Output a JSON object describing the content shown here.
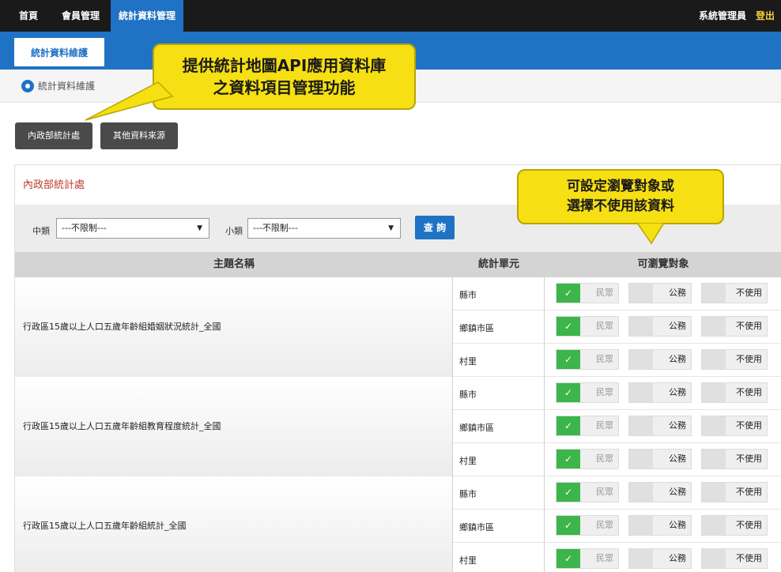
{
  "nav": {
    "items": [
      {
        "label": "首頁"
      },
      {
        "label": "會員管理"
      },
      {
        "label": "統計資料管理"
      }
    ],
    "user": "系統管理員",
    "logout": "登出"
  },
  "subnav": {
    "active_tab": "統計資料維護"
  },
  "breadcrumb": {
    "text": "統計資料維護"
  },
  "sources": {
    "buttons": [
      {
        "label": "內政部統計處"
      },
      {
        "label": "其他資料來源"
      }
    ]
  },
  "panel": {
    "title": "內政部統計處"
  },
  "filters": {
    "middle_label": "中類",
    "middle_value": "---不限制---",
    "small_label": "小類",
    "small_value": "---不限制---",
    "query_button": "查 詢"
  },
  "table": {
    "headers": {
      "topic": "主題名稱",
      "unit": "統計單元",
      "viewers": "可瀏覽對象"
    },
    "groups": [
      {
        "topic": "行政區15歲以上人口五歲年齡組婚姻狀況統計_全國",
        "rows": [
          {
            "unit": "縣市",
            "options": [
              {
                "label": "民眾",
                "on": true
              },
              {
                "label": "公務",
                "on": false
              },
              {
                "label": "不使用",
                "on": false
              }
            ]
          },
          {
            "unit": "鄉鎮市區",
            "options": [
              {
                "label": "民眾",
                "on": true
              },
              {
                "label": "公務",
                "on": false
              },
              {
                "label": "不使用",
                "on": false
              }
            ]
          },
          {
            "unit": "村里",
            "options": [
              {
                "label": "民眾",
                "on": true
              },
              {
                "label": "公務",
                "on": false
              },
              {
                "label": "不使用",
                "on": false
              }
            ]
          }
        ]
      },
      {
        "topic": "行政區15歲以上人口五歲年齡組教育程度統計_全國",
        "rows": [
          {
            "unit": "縣市",
            "options": [
              {
                "label": "民眾",
                "on": true
              },
              {
                "label": "公務",
                "on": false
              },
              {
                "label": "不使用",
                "on": false
              }
            ]
          },
          {
            "unit": "鄉鎮市區",
            "options": [
              {
                "label": "民眾",
                "on": true
              },
              {
                "label": "公務",
                "on": false
              },
              {
                "label": "不使用",
                "on": false
              }
            ]
          },
          {
            "unit": "村里",
            "options": [
              {
                "label": "民眾",
                "on": true
              },
              {
                "label": "公務",
                "on": false
              },
              {
                "label": "不使用",
                "on": false
              }
            ]
          }
        ]
      },
      {
        "topic": "行政區15歲以上人口五歲年齡組統計_全國",
        "rows": [
          {
            "unit": "縣市",
            "options": [
              {
                "label": "民眾",
                "on": true
              },
              {
                "label": "公務",
                "on": false
              },
              {
                "label": "不使用",
                "on": false
              }
            ]
          },
          {
            "unit": "鄉鎮市區",
            "options": [
              {
                "label": "民眾",
                "on": true
              },
              {
                "label": "公務",
                "on": false
              },
              {
                "label": "不使用",
                "on": false
              }
            ]
          },
          {
            "unit": "村里",
            "options": [
              {
                "label": "民眾",
                "on": true
              },
              {
                "label": "公務",
                "on": false
              },
              {
                "label": "不使用",
                "on": false
              }
            ]
          }
        ]
      }
    ]
  },
  "callouts": {
    "top": [
      "提供統計地圖API應用資料庫",
      "之資料項目管理功能"
    ],
    "right": [
      "可設定瀏覽對象或",
      "選擇不使用該資料"
    ]
  },
  "colors": {
    "primary": "#1f72c4",
    "callout": "#f6df12",
    "toggle_on": "#3cb54a",
    "title_red": "#c0392b"
  }
}
